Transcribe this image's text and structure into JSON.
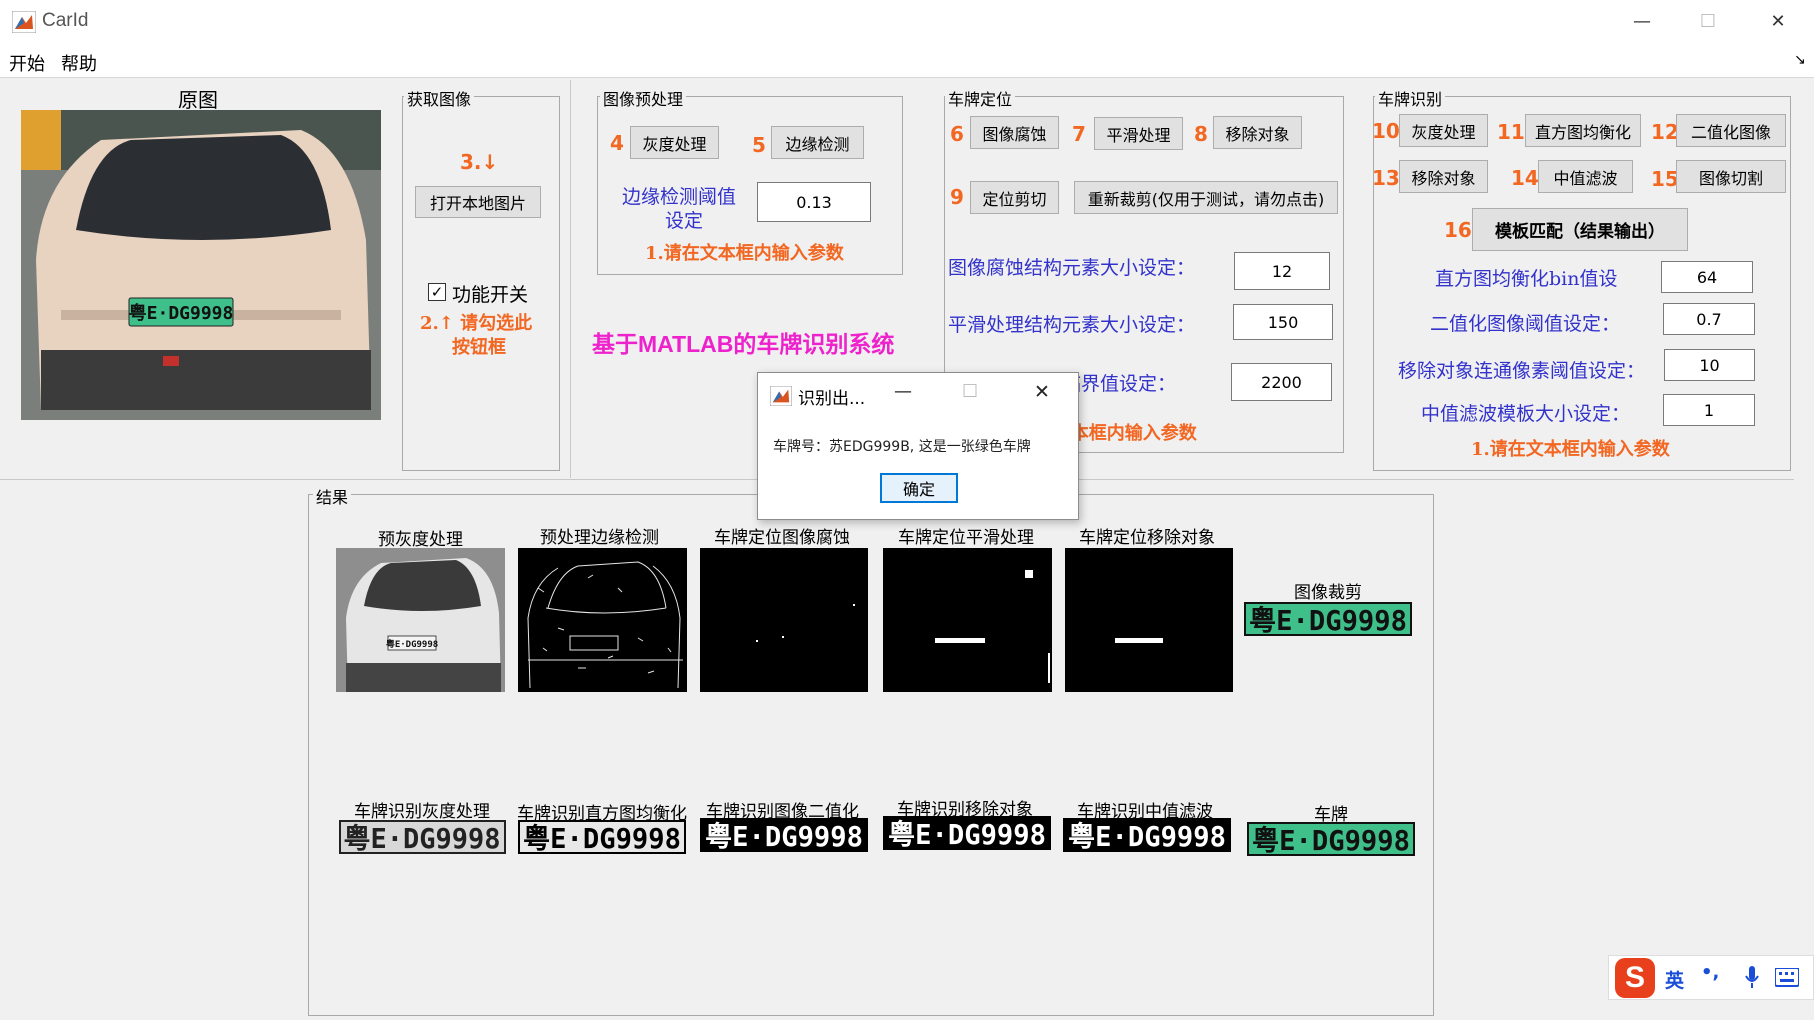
{
  "window": {
    "title": "CarId",
    "minimize_icon": "minimize-icon",
    "maximize_icon": "maximize-icon",
    "close_icon": "close-icon"
  },
  "menu": {
    "items": [
      "开始",
      "帮助"
    ]
  },
  "original": {
    "title": "原图",
    "plate_text": "粤E·DG9998"
  },
  "acquire": {
    "title": "获取图像",
    "step_hint": "3.↓",
    "open_button": "打开本地图片",
    "checkbox_label": "功能开关",
    "checkbox_checked": true,
    "hint_line1": "2.↑ 请勾选此",
    "hint_line2": "按钮框"
  },
  "preprocess": {
    "title": "图像预处理",
    "steps": [
      {
        "num": "4",
        "label": "灰度处理"
      },
      {
        "num": "5",
        "label": "边缘检测"
      }
    ],
    "threshold_label_1": "边缘检测阈值",
    "threshold_label_2": "设定",
    "threshold_value": "0.13",
    "hint": "1.请在文本框内输入参数"
  },
  "system_title": "基于MATLAB的车牌识别系统",
  "locate": {
    "title": "车牌定位",
    "steps": [
      {
        "num": "6",
        "label": "图像腐蚀"
      },
      {
        "num": "7",
        "label": "平滑处理"
      },
      {
        "num": "8",
        "label": "移除对象"
      },
      {
        "num": "9",
        "label": "定位剪切"
      }
    ],
    "recrop_button": "重新裁剪(仅用于测试，请勿点击)",
    "params": [
      {
        "label": "图像腐蚀结构元素大小设定：",
        "value": "12"
      },
      {
        "label": "平滑处理结构元素大小设定：",
        "value": "150"
      },
      {
        "label": "移除对象像素临界值设定：",
        "value": "2200"
      }
    ],
    "hint": "1.请在文本框内输入参数"
  },
  "recognize": {
    "title": "车牌识别",
    "steps": [
      {
        "num": "10",
        "label": "灰度处理"
      },
      {
        "num": "11",
        "label": "直方图均衡化"
      },
      {
        "num": "12",
        "label": "二值化图像"
      },
      {
        "num": "13",
        "label": "移除对象"
      },
      {
        "num": "14",
        "label": "中值滤波"
      },
      {
        "num": "15",
        "label": "图像切割"
      }
    ],
    "match_num": "16",
    "match_button": "模板匹配（结果输出）",
    "params": [
      {
        "label": "直方图均衡化bin值设",
        "value": "64"
      },
      {
        "label": "二值化图像阈值设定：",
        "value": "0.7"
      },
      {
        "label": "移除对象连通像素阈值设定：",
        "value": "10"
      },
      {
        "label": "中值滤波模板大小设定：",
        "value": "1"
      }
    ],
    "hint": "1.请在文本框内输入参数"
  },
  "results": {
    "title": "结果",
    "row1": [
      "预灰度处理",
      "预处理边缘检测",
      "车牌定位图像腐蚀",
      "车牌定位平滑处理",
      "车牌定位移除对象",
      "图像裁剪"
    ],
    "row2": [
      "车牌识别灰度处理",
      "车牌识别直方图均衡化",
      "车牌识别图像二值化",
      "车牌识别移除对象",
      "车牌识别中值滤波",
      "车牌"
    ],
    "plate_text": "粤E·DG9998"
  },
  "dialog": {
    "title": "识别出...",
    "message": "车牌号：苏EDG999B, 这是一张绿色车牌",
    "ok_button": "确定"
  },
  "ime": {
    "lang": "英",
    "punct": "•,",
    "mic_icon": "microphone-icon",
    "keyboard_icon": "keyboard-icon"
  },
  "colors": {
    "accent_orange": "#f26722",
    "label_blue": "#3333cc",
    "title_magenta": "#ee22cc",
    "plate_green": "#3fbf8a"
  }
}
